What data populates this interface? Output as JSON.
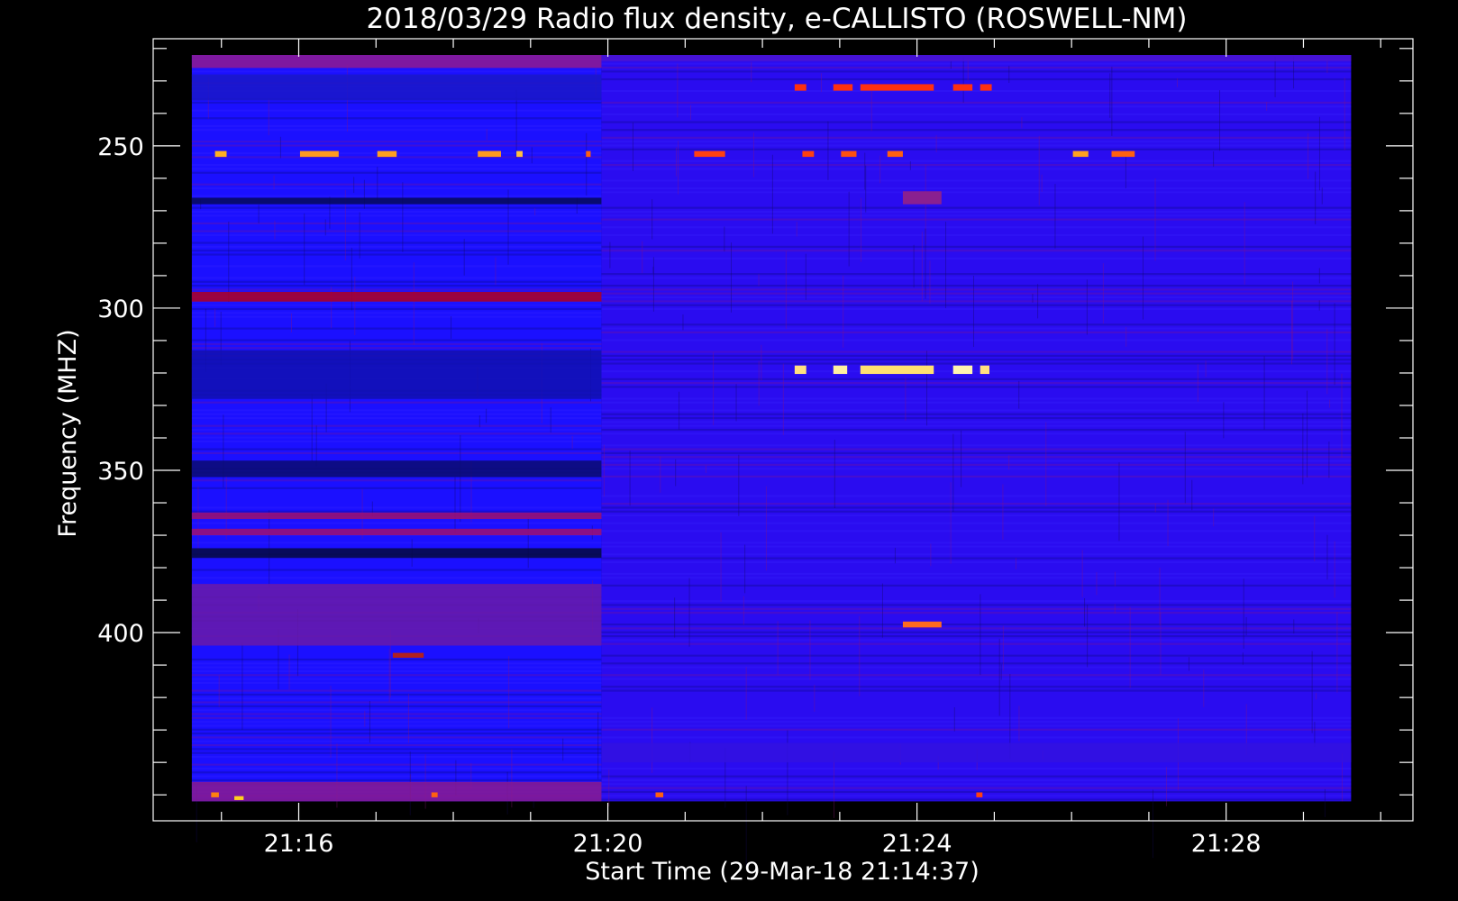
{
  "chart_data": {
    "type": "heatmap",
    "title": "2018/03/29  Radio flux density, e-CALLISTO (ROSWELL-NM)",
    "xlabel": "Start Time (29-Mar-18 21:14:37)",
    "ylabel": "Frequency (MHZ)",
    "x_unit": "minutes",
    "xlim": [
      -0.5,
      15.8
    ],
    "ylim": [
      217,
      458
    ],
    "y_inverted": true,
    "data_x_range": [
      0,
      15
    ],
    "data_y_range": [
      222,
      452
    ],
    "x_ticks": [
      {
        "value": 1.383,
        "label": "21:16"
      },
      {
        "value": 5.383,
        "label": "21:20"
      },
      {
        "value": 9.383,
        "label": "21:24"
      },
      {
        "value": 13.383,
        "label": "21:28"
      }
    ],
    "x_minor_step": 1,
    "y_ticks": [
      {
        "value": 250,
        "label": "250"
      },
      {
        "value": 300,
        "label": "300"
      },
      {
        "value": 350,
        "label": "350"
      },
      {
        "value": 400,
        "label": "400"
      }
    ],
    "y_minor_step": 10,
    "grid": false,
    "colors": {
      "background": "#000000",
      "axes": "#ffffff",
      "low_intensity": "#1a00ff",
      "medium_intensity": "#8a0090",
      "high_intensity": "#ff2000",
      "peak_intensity": "#ffff80"
    },
    "segments": [
      {
        "t_start": 0,
        "t_end": 5.3,
        "background": "#1b10ff"
      },
      {
        "t_start": 5.3,
        "t_end": 15,
        "background": "#2a0cf0"
      }
    ],
    "horizontal_bands": [
      {
        "t_start": 0,
        "t_end": 5.3,
        "f_start": 222,
        "f_end": 226,
        "color": "#8f1a8f"
      },
      {
        "t_start": 0,
        "t_end": 5.3,
        "f_start": 228,
        "f_end": 236,
        "color": "#1a18c8"
      },
      {
        "t_start": 0,
        "t_end": 5.3,
        "f_start": 266,
        "f_end": 268,
        "color": "#050a55"
      },
      {
        "t_start": 0,
        "t_end": 5.3,
        "f_start": 295,
        "f_end": 298,
        "color": "#b00020"
      },
      {
        "t_start": 0,
        "t_end": 5.3,
        "f_start": 313,
        "f_end": 328,
        "color": "#1010b0"
      },
      {
        "t_start": 0,
        "t_end": 5.3,
        "f_start": 347,
        "f_end": 352,
        "color": "#0a0c70"
      },
      {
        "t_start": 0,
        "t_end": 5.3,
        "f_start": 363,
        "f_end": 365,
        "color": "#a01070"
      },
      {
        "t_start": 0,
        "t_end": 5.3,
        "f_start": 368,
        "f_end": 370,
        "color": "#a01070"
      },
      {
        "t_start": 0,
        "t_end": 5.3,
        "f_start": 374,
        "f_end": 377,
        "color": "#050a40"
      },
      {
        "t_start": 0,
        "t_end": 5.3,
        "f_start": 385,
        "f_end": 404,
        "color": "#6a1aa8"
      },
      {
        "t_start": 0,
        "t_end": 5.3,
        "f_start": 446,
        "f_end": 452,
        "color": "#8a1a90"
      },
      {
        "t_start": 5.3,
        "t_end": 15,
        "f_start": 222,
        "f_end": 224,
        "color": "#4a14d0"
      },
      {
        "t_start": 5.3,
        "t_end": 15,
        "f_start": 434,
        "f_end": 440,
        "color": "#3212e0"
      }
    ],
    "bursts": [
      {
        "t": 0.3,
        "dt": 0.15,
        "f": 252.5,
        "df": 1.8,
        "color": "#ffb020"
      },
      {
        "t": 1.4,
        "dt": 0.5,
        "f": 252.5,
        "df": 1.8,
        "color": "#ff9a20"
      },
      {
        "t": 2.4,
        "dt": 0.25,
        "f": 252.5,
        "df": 1.8,
        "color": "#ffa020"
      },
      {
        "t": 3.7,
        "dt": 0.3,
        "f": 252.5,
        "df": 1.8,
        "color": "#ff9a20"
      },
      {
        "t": 4.2,
        "dt": 0.08,
        "f": 252.5,
        "df": 1.8,
        "color": "#ffc040"
      },
      {
        "t": 5.1,
        "dt": 0.06,
        "f": 252.5,
        "df": 1.8,
        "color": "#ff6010"
      },
      {
        "t": 6.5,
        "dt": 0.4,
        "f": 252.5,
        "df": 1.8,
        "color": "#ff4010"
      },
      {
        "t": 7.9,
        "dt": 0.15,
        "f": 252.5,
        "df": 1.8,
        "color": "#ff4010"
      },
      {
        "t": 8.4,
        "dt": 0.2,
        "f": 252.5,
        "df": 1.8,
        "color": "#ff5010"
      },
      {
        "t": 9.0,
        "dt": 0.2,
        "f": 252.5,
        "df": 1.8,
        "color": "#ff6010"
      },
      {
        "t": 11.4,
        "dt": 0.2,
        "f": 252.5,
        "df": 1.8,
        "color": "#ffa020"
      },
      {
        "t": 11.9,
        "dt": 0.3,
        "f": 252.5,
        "df": 1.8,
        "color": "#ff6010"
      },
      {
        "t": 7.8,
        "dt": 0.15,
        "f": 232,
        "df": 2,
        "color": "#ff3010"
      },
      {
        "t": 8.3,
        "dt": 0.25,
        "f": 232,
        "df": 2,
        "color": "#ff3010"
      },
      {
        "t": 8.65,
        "dt": 0.95,
        "f": 232,
        "df": 2,
        "color": "#ff3010"
      },
      {
        "t": 9.85,
        "dt": 0.25,
        "f": 232,
        "df": 2,
        "color": "#ff3010"
      },
      {
        "t": 10.2,
        "dt": 0.15,
        "f": 232,
        "df": 2,
        "color": "#ff3010"
      },
      {
        "t": 7.8,
        "dt": 0.15,
        "f": 319,
        "df": 2.6,
        "color": "#ffe080"
      },
      {
        "t": 8.3,
        "dt": 0.18,
        "f": 319,
        "df": 2.6,
        "color": "#fff0a0"
      },
      {
        "t": 8.65,
        "dt": 0.95,
        "f": 319,
        "df": 2.6,
        "color": "#ffe070"
      },
      {
        "t": 9.85,
        "dt": 0.25,
        "f": 319,
        "df": 2.6,
        "color": "#fff4b0"
      },
      {
        "t": 10.2,
        "dt": 0.12,
        "f": 319,
        "df": 2.6,
        "color": "#ffe080"
      },
      {
        "t": 9.2,
        "dt": 0.5,
        "f": 397.5,
        "df": 1.8,
        "color": "#ff6a20"
      },
      {
        "t": 2.6,
        "dt": 0.4,
        "f": 407,
        "df": 1.5,
        "color": "#b02020"
      },
      {
        "t": 9.2,
        "dt": 0.5,
        "f": 266,
        "df": 4,
        "color": "#8a2090"
      },
      {
        "t": 0.25,
        "dt": 0.1,
        "f": 450,
        "df": 1.5,
        "color": "#ff8010"
      },
      {
        "t": 0.55,
        "dt": 0.12,
        "f": 451,
        "df": 1.2,
        "color": "#ffd020"
      },
      {
        "t": 3.1,
        "dt": 0.08,
        "f": 450,
        "df": 1.5,
        "color": "#ff6010"
      },
      {
        "t": 6.0,
        "dt": 0.1,
        "f": 450,
        "df": 1.5,
        "color": "#ff6010"
      },
      {
        "t": 10.15,
        "dt": 0.08,
        "f": 450,
        "df": 1.5,
        "color": "#ff4010"
      }
    ]
  }
}
